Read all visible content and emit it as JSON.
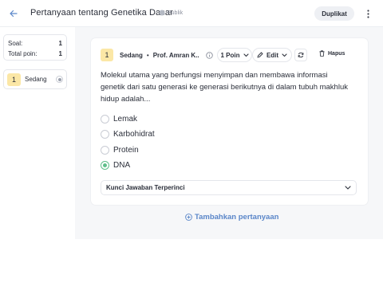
{
  "header": {
    "title": "Pertanyaan tentang Genetika Dasar",
    "visibility": "Publik",
    "duplicate_label": "Duplikat"
  },
  "summary": {
    "questions_label": "Soal:",
    "questions_value": "1",
    "points_label": "Total poin:",
    "points_value": "1"
  },
  "question_list": [
    {
      "number": "1",
      "difficulty": "Sedang"
    }
  ],
  "question_card": {
    "number": "1",
    "difficulty": "Sedang",
    "separator": "•",
    "author": "Prof. Amran K...",
    "points_label": "1 Poin",
    "edit_label": "Edit",
    "delete_label": "Hapus",
    "text": "Molekul utama yang berfungsi menyimpan dan membawa informasi genetik dari satu generasi ke generasi berikutnya di dalam tubuh makhluk hidup adalah...",
    "options": [
      {
        "label": "Lemak",
        "correct": false
      },
      {
        "label": "Karbohidrat",
        "correct": false
      },
      {
        "label": "Protein",
        "correct": false
      },
      {
        "label": "DNA",
        "correct": true
      }
    ],
    "answer_key_label": "Kunci Jawaban Terperinci"
  },
  "add_question_label": "Tambahkan pertanyaan",
  "colors": {
    "accent_blue": "#5a86c9",
    "badge_yellow": "#fbe7a6",
    "correct_green": "#5fbf8a"
  },
  "icons": [
    "arrow-left-icon",
    "globe-icon",
    "more-vertical-icon",
    "info-icon",
    "chevron-down-icon",
    "pencil-icon",
    "refresh-icon",
    "trash-icon",
    "plus-circle-icon"
  ]
}
